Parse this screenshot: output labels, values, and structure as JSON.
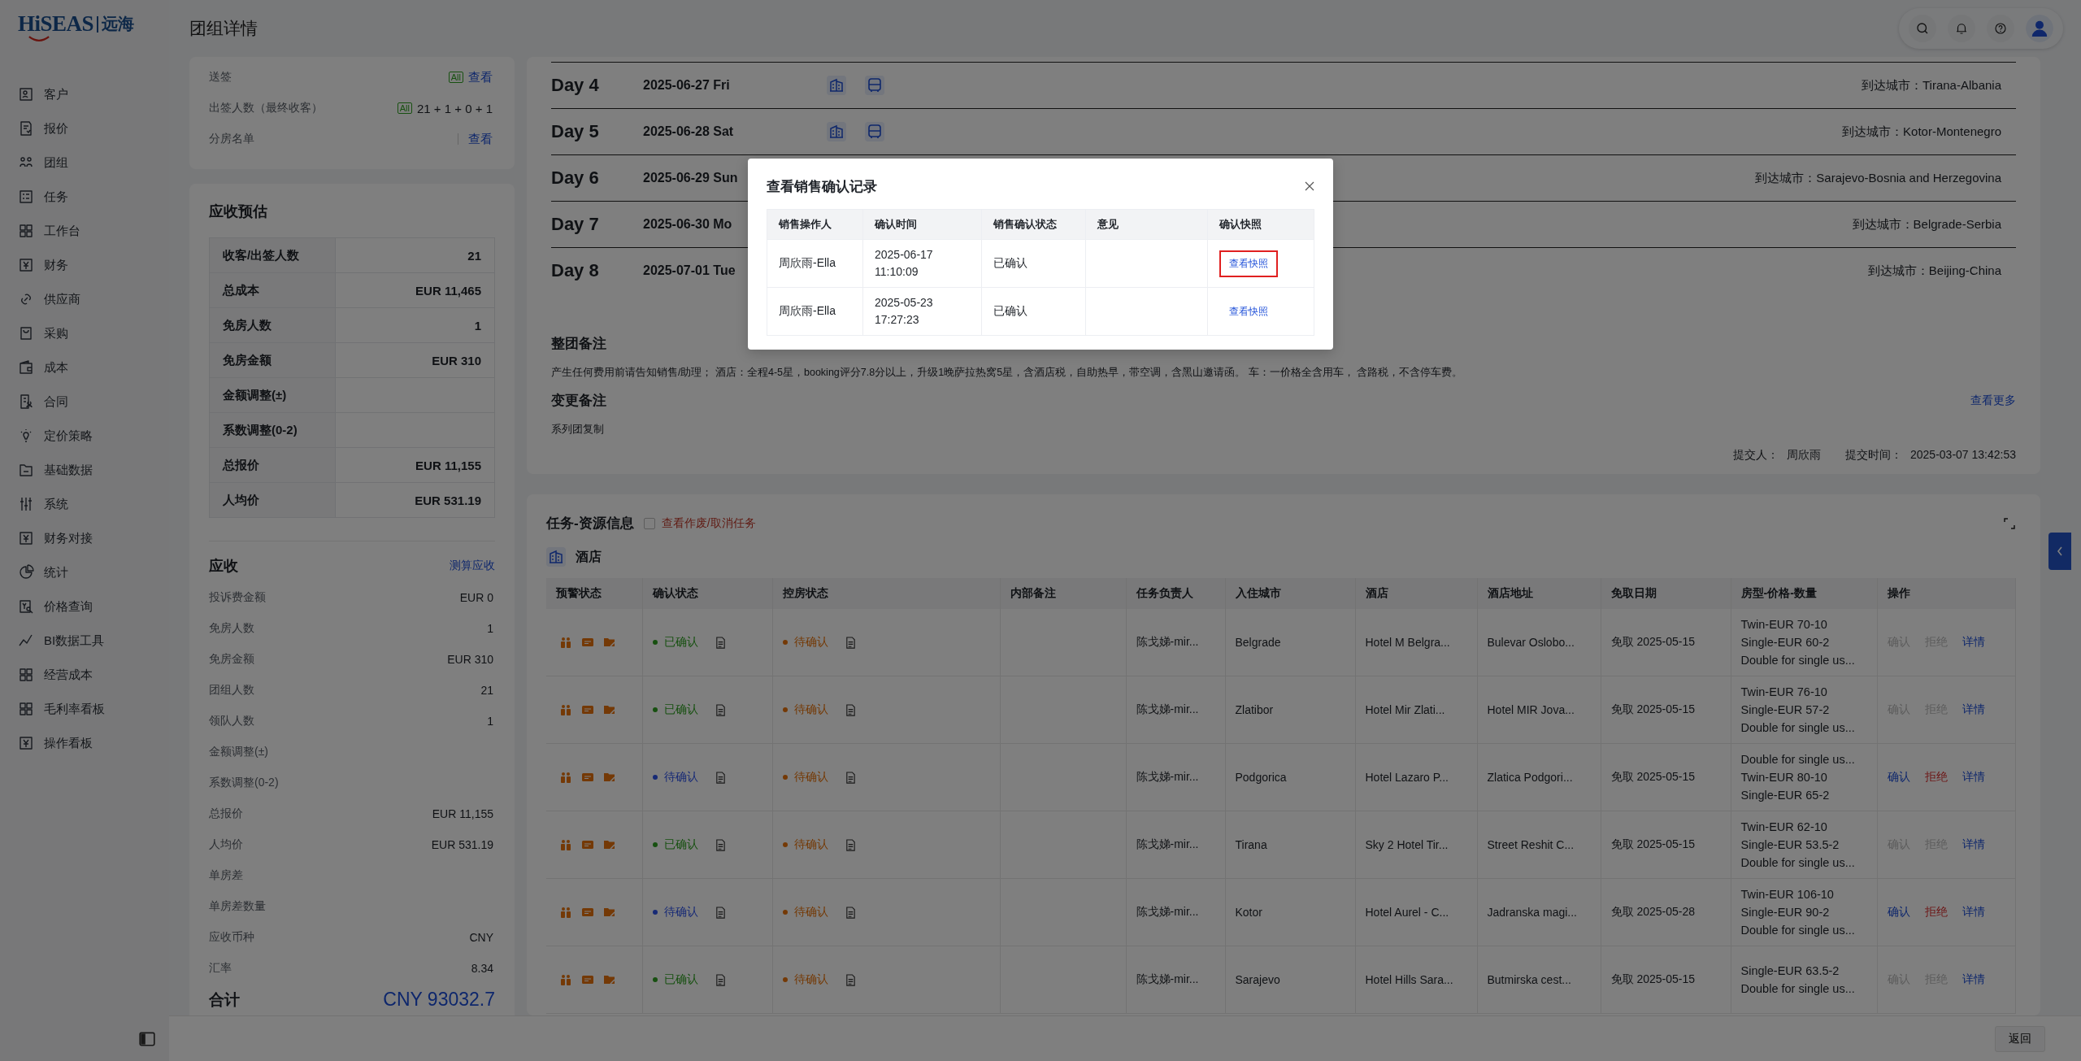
{
  "logo": {
    "brand": "HiSEAS",
    "suffix": "远海"
  },
  "page_title": "团组详情",
  "sidebar": {
    "items": [
      {
        "label": "客户"
      },
      {
        "label": "报价"
      },
      {
        "label": "团组"
      },
      {
        "label": "任务"
      },
      {
        "label": "工作台"
      },
      {
        "label": "财务"
      },
      {
        "label": "供应商"
      },
      {
        "label": "采购"
      },
      {
        "label": "成本"
      },
      {
        "label": "合同"
      },
      {
        "label": "定价策略"
      },
      {
        "label": "基础数据"
      },
      {
        "label": "系统"
      },
      {
        "label": "财务对接"
      },
      {
        "label": "统计"
      },
      {
        "label": "价格查询"
      },
      {
        "label": "BI数据工具"
      },
      {
        "label": "经营成本"
      },
      {
        "label": "毛利率看板"
      },
      {
        "label": "操作看板"
      }
    ]
  },
  "visa": {
    "rows": [
      {
        "label": "送签",
        "badge": "All",
        "value": "查看",
        "kind": "link"
      },
      {
        "label": "出签人数（最终收客）",
        "badge": "All",
        "value": "21 + 1 + 0 + 1",
        "kind": "text"
      },
      {
        "label": "分房名单",
        "value": "查看",
        "kind": "link"
      }
    ]
  },
  "estimate": {
    "title": "应收预估",
    "rows": [
      {
        "label": "收客/出签人数",
        "value": "21"
      },
      {
        "label": "总成本",
        "value": "EUR 11,465"
      },
      {
        "label": "免房人数",
        "value": "1"
      },
      {
        "label": "免房金额",
        "value": "EUR 310"
      },
      {
        "label": "金额调整(±)"
      },
      {
        "label": "系数调整(0-2)"
      },
      {
        "label": "总报价",
        "value": "EUR 11,155"
      },
      {
        "label": "人均价",
        "value": "EUR 531.19"
      }
    ]
  },
  "receivable": {
    "title": "应收",
    "action": "测算应收",
    "rows": [
      {
        "label": "投诉费金额",
        "value": "EUR 0"
      },
      {
        "label": "免房人数",
        "value": "1"
      },
      {
        "label": "免房金额",
        "value": "EUR 310"
      },
      {
        "label": "团组人数",
        "value": "21"
      },
      {
        "label": "领队人数",
        "value": "1"
      },
      {
        "label": "金额调整(±)"
      },
      {
        "label": "系数调整(0-2)"
      },
      {
        "label": "总报价",
        "value": "EUR 11,155"
      },
      {
        "label": "人均价",
        "value": "EUR 531.19"
      },
      {
        "label": "单房差"
      },
      {
        "label": "单房差数量"
      },
      {
        "label": "应收币种",
        "value": "CNY"
      },
      {
        "label": "汇率",
        "value": "8.34"
      }
    ],
    "total_label": "合计",
    "total": "CNY 93032.7"
  },
  "itinerary": {
    "days": [
      {
        "day": "Day 4",
        "date": "2025-06-27 Fri",
        "icons_shown": true,
        "arrival": "到达城市：Tirana-Albania"
      },
      {
        "day": "Day 5",
        "date": "2025-06-28 Sat",
        "icons_shown": true,
        "arrival": "到达城市：Kotor-Montenegro"
      },
      {
        "day": "Day 6",
        "date": "2025-06-29 Sun",
        "arrival": "到达城市：Sarajevo-Bosnia and Herzegovina"
      },
      {
        "day": "Day 7",
        "date": "2025-06-30 Mo",
        "arrival": "到达城市：Belgrade-Serbia"
      },
      {
        "day": "Day 8",
        "date": "2025-07-01 Tue",
        "arrival": "到达城市：Beijing-China"
      }
    ],
    "group_note_title": "整团备注",
    "group_note": "产生任何费用前请告知销售/助理； 酒店：全程4-5星，booking评分7.8分以上，升级1晚萨拉热窝5星，含酒店税，自助热早，带空调，含黑山邀请函。 车：一价格全含用车， 含路税，不含停车费。",
    "change_note_title": "变更备注",
    "more": "查看更多",
    "change_note": "系列团复制",
    "submitter_label": "提交人：",
    "submitter": "周欣雨",
    "submit_time_label": "提交时间：",
    "submit_time": "2025-03-07 13:42:53"
  },
  "tasks": {
    "title": "任务-资源信息",
    "toggle": {
      "label": "查看作废/取消任务",
      "checked": false
    },
    "section": "酒店",
    "columns": [
      "预警状态",
      "确认状态",
      "控房状态",
      "内部备注",
      "任务负责人",
      "入住城市",
      "酒店",
      "酒店地址",
      "免取日期",
      "房型-价格-数量",
      "操作"
    ],
    "rows": [
      {
        "confirm": {
          "label": "已确认",
          "kind": "confirmed"
        },
        "room": {
          "label": "待确认",
          "kind": "awaiting"
        },
        "owner": "陈戈娣-mir...",
        "city": "Belgrade",
        "hotel": "Hotel M Belgra...",
        "address": "Bulevar Oslobo...",
        "date": "免取 2025-05-15",
        "rooms": [
          "Twin-EUR 70-10",
          "Single-EUR 60-2",
          "Double for single us..."
        ],
        "actions": [
          {
            "label": "确认",
            "kind": "confirm",
            "disabled": true
          },
          {
            "label": "拒绝",
            "kind": "reject",
            "disabled": true
          },
          {
            "label": "详情",
            "kind": "detail",
            "disabled": false
          }
        ]
      },
      {
        "confirm": {
          "label": "已确认",
          "kind": "confirmed"
        },
        "room": {
          "label": "待确认",
          "kind": "awaiting"
        },
        "owner": "陈戈娣-mir...",
        "city": "Zlatibor",
        "hotel": "Hotel Mir Zlati...",
        "address": "Hotel MIR Jova...",
        "date": "免取 2025-05-15",
        "rooms": [
          "Twin-EUR 76-10",
          "Single-EUR 57-2",
          "Double for single us..."
        ],
        "actions": [
          {
            "label": "确认",
            "kind": "confirm",
            "disabled": true
          },
          {
            "label": "拒绝",
            "kind": "reject",
            "disabled": true
          },
          {
            "label": "详情",
            "kind": "detail",
            "disabled": false
          }
        ]
      },
      {
        "confirm": {
          "label": "待确认",
          "kind": "pending"
        },
        "room": {
          "label": "待确认",
          "kind": "awaiting"
        },
        "owner": "陈戈娣-mir...",
        "city": "Podgorica",
        "hotel": "Hotel Lazaro P...",
        "address": "Zlatica Podgori...",
        "date": "免取 2025-05-15",
        "rooms": [
          "Double for single us...",
          "Twin-EUR 80-10",
          "Single-EUR 65-2"
        ],
        "actions": [
          {
            "label": "确认",
            "kind": "confirm",
            "disabled": false
          },
          {
            "label": "拒绝",
            "kind": "reject",
            "disabled": false
          },
          {
            "label": "详情",
            "kind": "detail",
            "disabled": false
          }
        ]
      },
      {
        "confirm": {
          "label": "已确认",
          "kind": "confirmed"
        },
        "room": {
          "label": "待确认",
          "kind": "awaiting"
        },
        "owner": "陈戈娣-mir...",
        "city": "Tirana",
        "hotel": "Sky 2 Hotel Tir...",
        "address": "Street Reshit C...",
        "date": "免取 2025-05-15",
        "rooms": [
          "Twin-EUR 62-10",
          "Single-EUR 53.5-2",
          "Double for single us..."
        ],
        "actions": [
          {
            "label": "确认",
            "kind": "confirm",
            "disabled": true
          },
          {
            "label": "拒绝",
            "kind": "reject",
            "disabled": true
          },
          {
            "label": "详情",
            "kind": "detail",
            "disabled": false
          }
        ]
      },
      {
        "confirm": {
          "label": "待确认",
          "kind": "pending"
        },
        "room": {
          "label": "待确认",
          "kind": "awaiting"
        },
        "owner": "陈戈娣-mir...",
        "city": "Kotor",
        "hotel": "Hotel Aurel - C...",
        "address": "Jadranska magi...",
        "date": "免取 2025-05-28",
        "rooms": [
          "Twin-EUR 106-10",
          "Single-EUR 90-2",
          "Double for single us..."
        ],
        "actions": [
          {
            "label": "确认",
            "kind": "confirm",
            "disabled": false
          },
          {
            "label": "拒绝",
            "kind": "reject",
            "disabled": false
          },
          {
            "label": "详情",
            "kind": "detail",
            "disabled": false
          }
        ]
      },
      {
        "confirm": {
          "label": "已确认",
          "kind": "confirmed"
        },
        "room": {
          "label": "待确认",
          "kind": "awaiting"
        },
        "owner": "陈戈娣-mir...",
        "city": "Sarajevo",
        "hotel": "Hotel Hills Sara...",
        "address": "Butmirska cest...",
        "date": "免取 2025-05-15",
        "rooms": [
          "Single-EUR 63.5-2",
          "Double for single us..."
        ],
        "actions": [
          {
            "label": "确认",
            "kind": "confirm",
            "disabled": true
          },
          {
            "label": "拒绝",
            "kind": "reject",
            "disabled": true
          },
          {
            "label": "详情",
            "kind": "detail",
            "disabled": false
          }
        ]
      }
    ]
  },
  "footer": {
    "back": "返回"
  },
  "modal": {
    "title": "查看销售确认记录",
    "columns": [
      "销售操作人",
      "确认时间",
      "销售确认状态",
      "意见",
      "确认快照"
    ],
    "rows": [
      {
        "operator": "周欣雨-Ella",
        "time": "2025-06-17 11:10:09",
        "status": "已确认",
        "link": "查看快照",
        "highlighted": true
      },
      {
        "operator": "周欣雨-Ella",
        "time": "2025-05-23 17:27:23",
        "status": "已确认",
        "link": "查看快照",
        "highlighted": false
      }
    ]
  }
}
